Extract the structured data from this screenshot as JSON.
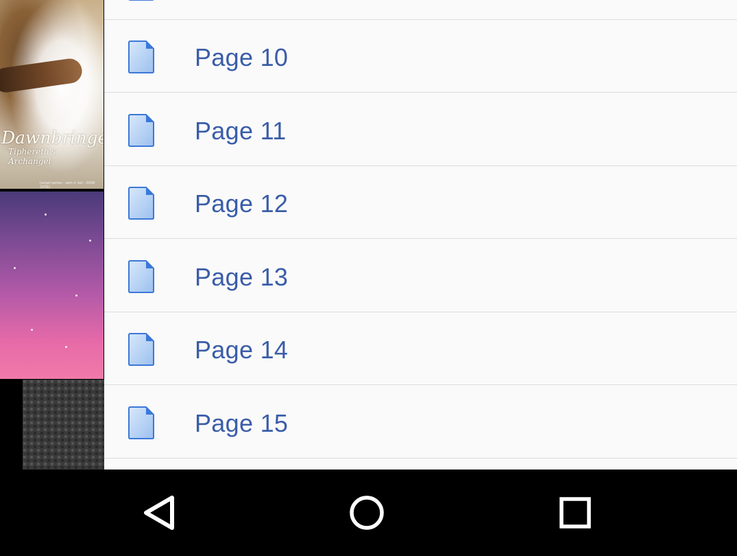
{
  "pages": [
    {
      "label": "Page 10"
    },
    {
      "label": "Page 11"
    },
    {
      "label": "Page 12"
    },
    {
      "label": "Page 13"
    },
    {
      "label": "Page 14"
    },
    {
      "label": "Page 15"
    }
  ],
  "thumbnails": {
    "thumb1_title": "Dawnbringer",
    "thumb1_subtitle": "Tiphereth's Archangel",
    "thumb1_caption": "[angel series - sam rr lsd - 2008-2009]"
  },
  "icons": {
    "page": "page-icon",
    "back": "back-icon",
    "home": "home-icon",
    "recents": "recents-icon"
  },
  "colors": {
    "label": "#3a5da8",
    "icon_fill": "#a9c9f2",
    "icon_stroke": "#3b78d8",
    "list_bg": "#fafafa",
    "navbar_bg": "#000000"
  }
}
